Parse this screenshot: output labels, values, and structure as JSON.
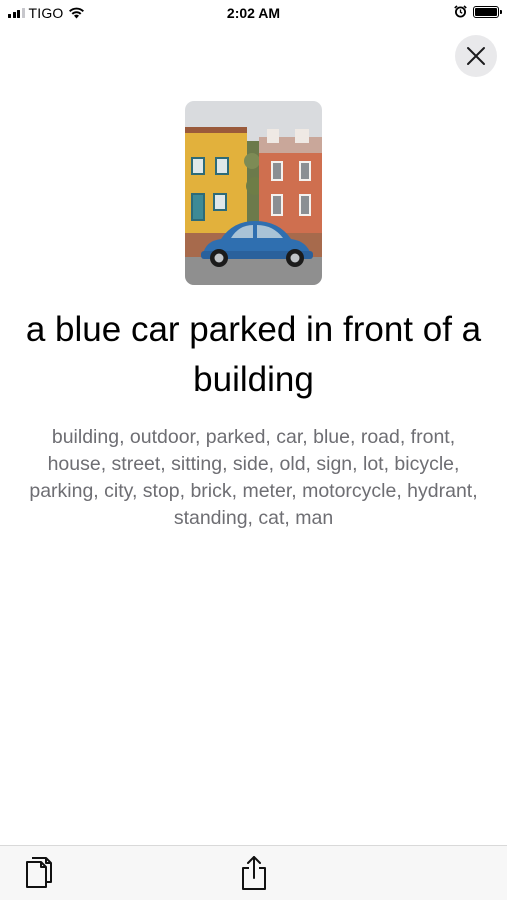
{
  "status_bar": {
    "carrier": "TIGO",
    "time": "2:02 AM",
    "icons": [
      "signal-icon",
      "wifi-icon",
      "alarm-icon",
      "battery-icon"
    ]
  },
  "close_button": {
    "icon": "close-icon"
  },
  "photo": {
    "description_icon": "photo-thumbnail"
  },
  "caption": {
    "title": "a blue car parked in front of a building",
    "tags": "building, outdoor, parked, car, blue, road, front, house, street, sitting, side, old, sign, lot, bicycle, parking, city, stop, brick, meter, motorcycle, hydrant, standing, cat, man"
  },
  "toolbar": {
    "copy_icon": "copy-icon",
    "share_icon": "share-icon"
  },
  "colors": {
    "text_primary": "#000000",
    "text_secondary": "#6e6e73",
    "toolbar_bg": "#f7f7f7",
    "close_bg": "#e9e9eb",
    "car_blue": "#2f6fb0"
  }
}
